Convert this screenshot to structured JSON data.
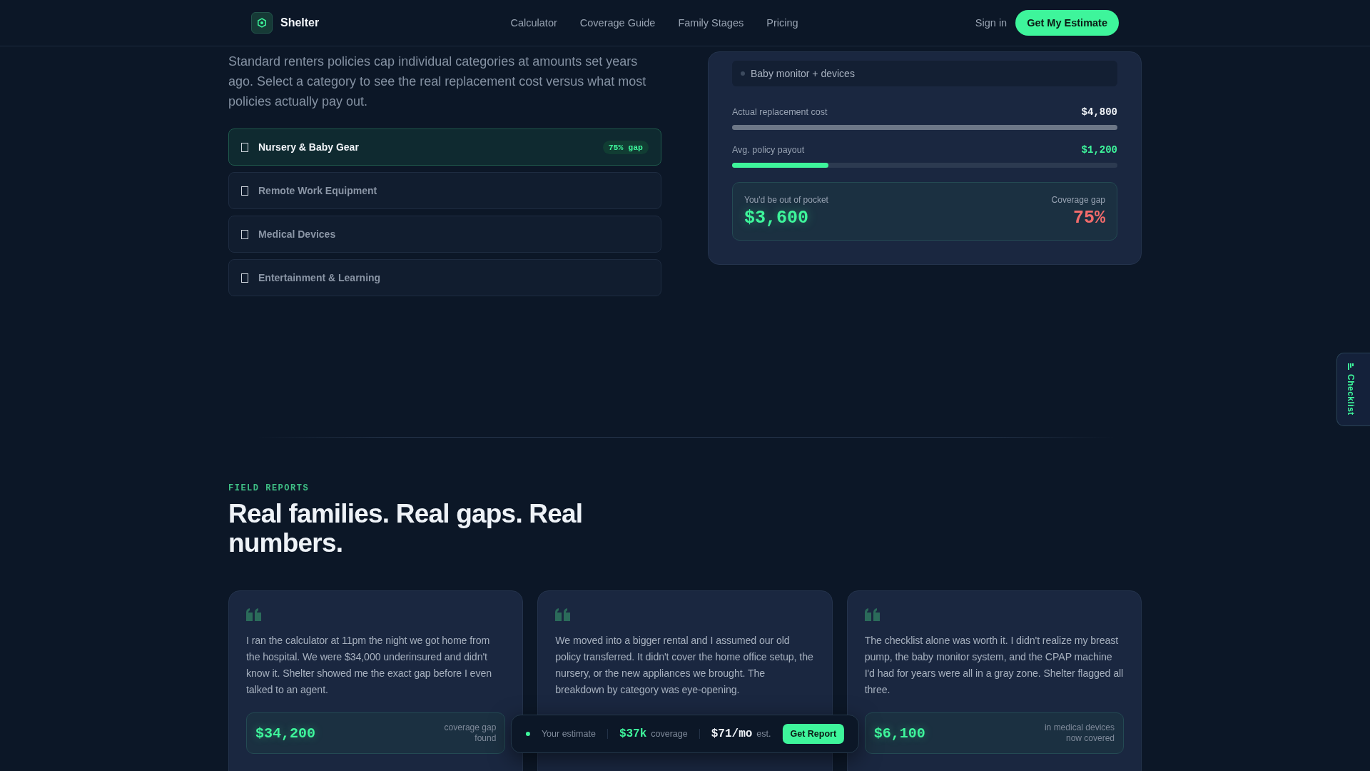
{
  "nav": {
    "brand": "Shelter",
    "links": [
      {
        "label": "Calculator"
      },
      {
        "label": "Coverage Guide"
      },
      {
        "label": "Family Stages"
      },
      {
        "label": "Pricing"
      }
    ],
    "sign_in": "Sign in",
    "cta": "Get My Estimate"
  },
  "intro": "Standard renters policies cap individual categories at amounts set years ago. Select a category to see the real replacement cost versus what most policies actually pay out.",
  "categories": [
    {
      "label": "Nursery & Baby Gear",
      "selected": true,
      "badge": "75% gap"
    },
    {
      "label": "Remote Work Equipment",
      "selected": false
    },
    {
      "label": "Medical Devices",
      "selected": false
    },
    {
      "label": "Entertainment & Learning",
      "selected": false
    }
  ],
  "breakdown": {
    "items": [
      "Baby monitor + devices"
    ],
    "bars": [
      {
        "kind": "cost",
        "label": "Actual replacement cost",
        "value": "$4,800",
        "level": 1
      },
      {
        "kind": "payout",
        "label": "Avg. policy payout",
        "value": "$1,200",
        "level": 0.25
      }
    ],
    "summary": {
      "out_of_pocket_label": "You'd be out of pocket",
      "out_of_pocket": "$3,600",
      "gap_label": "Coverage gap",
      "gap": "75%"
    }
  },
  "side_tab": {
    "label": "Checklist"
  },
  "field_reports": {
    "eyebrow": "FIELD REPORTS",
    "title": "Real families. Real gaps. Real numbers.",
    "reports": [
      {
        "quote": "I ran the calculator at 11pm the night we got home from the hospital. We were $34,000 underinsured and didn't know it. Shelter showed me the exact gap before I even talked to an agent.",
        "stat": "$34,200",
        "stat_label": "coverage gap found"
      },
      {
        "quote": "We moved into a bigger rental and I assumed our old policy transferred. It didn't cover the home office setup, the nursery, or the new appliances we brought. The breakdown by category was eye-opening."
      },
      {
        "quote": "The checklist alone was worth it. I didn't realize my breast pump, the baby monitor system, and the CPAP machine I'd had for years were all in a gray zone. Shelter flagged all three.",
        "stat": "$6,100",
        "stat_label": "in medical devices now covered"
      }
    ]
  },
  "estimate_bar": {
    "label": "Your estimate",
    "coverage": "$37k",
    "coverage_label": "coverage",
    "monthly": "$71/mo",
    "monthly_label": "est.",
    "button": "Get Report"
  }
}
